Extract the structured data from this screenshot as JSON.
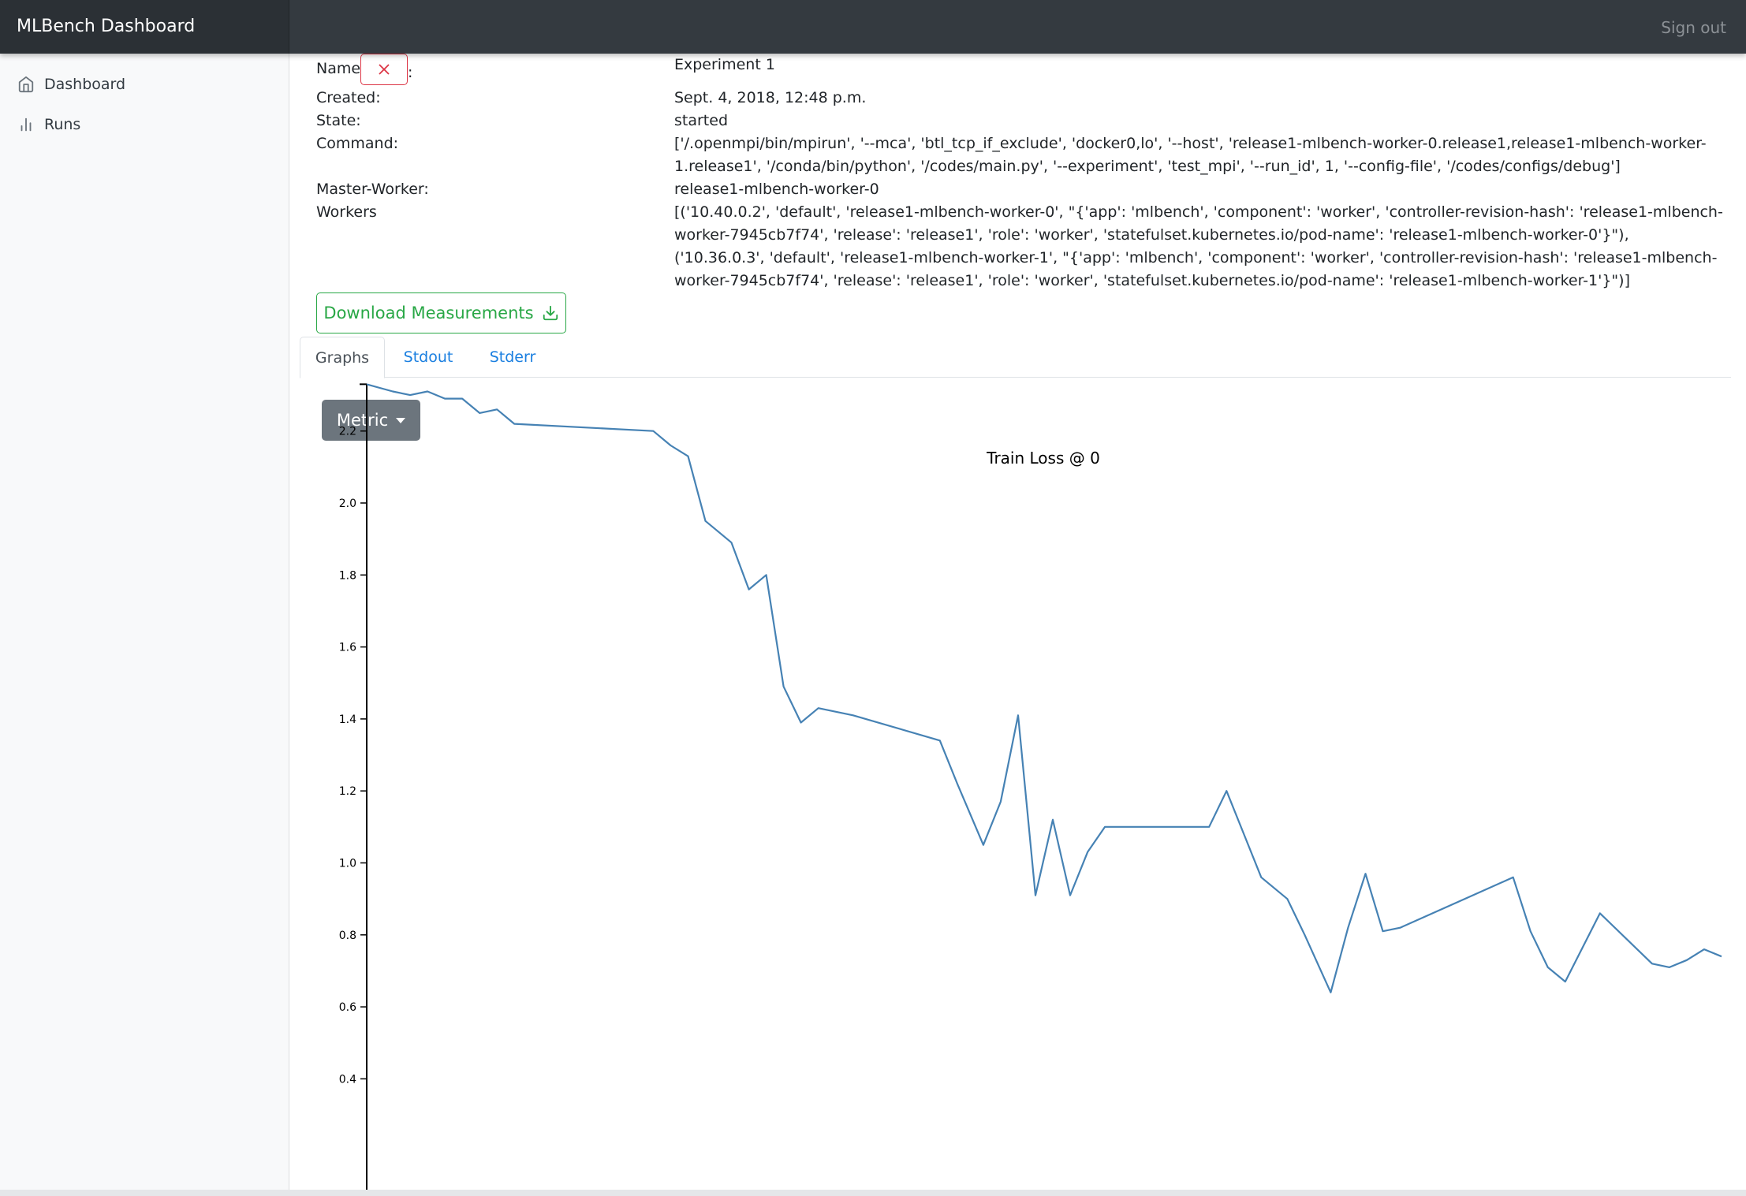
{
  "header": {
    "brand": "MLBench Dashboard",
    "signout_label": "Sign out"
  },
  "sidebar": {
    "items": [
      {
        "label": "Dashboard",
        "icon": "home-icon"
      },
      {
        "label": "Runs",
        "icon": "bar-chart-icon"
      }
    ]
  },
  "run": {
    "name_label": "Name",
    "name_value": "Experiment 1",
    "created_label": "Created:",
    "created_value": "Sept. 4, 2018, 12:48 p.m.",
    "state_label": "State:",
    "state_value": "started",
    "command_label": "Command:",
    "command_value": "['/.openmpi/bin/mpirun', '--mca', 'btl_tcp_if_exclude', 'docker0,lo', '--host', 'release1-mlbench-worker-0.release1,release1-mlbench-worker-1.release1', '/conda/bin/python', '/codes/main.py', '--experiment', 'test_mpi', '--run_id', 1, '--config-file', '/codes/configs/debug']",
    "master_label": "Master-Worker:",
    "master_value": "release1-mlbench-worker-0",
    "workers_label": "Workers",
    "workers_value": "[('10.40.0.2', 'default', 'release1-mlbench-worker-0', \"{'app': 'mlbench', 'component': 'worker', 'controller-revision-hash': 'release1-mlbench-worker-7945cb7f74', 'release': 'release1', 'role': 'worker', 'statefulset.kubernetes.io/pod-name': 'release1-mlbench-worker-0'}\"), ('10.36.0.3', 'default', 'release1-mlbench-worker-1', \"{'app': 'mlbench', 'component': 'worker', 'controller-revision-hash': 'release1-mlbench-worker-7945cb7f74', 'release': 'release1', 'role': 'worker', 'statefulset.kubernetes.io/pod-name': 'release1-mlbench-worker-1'}\")]"
  },
  "actions": {
    "download_label": "Download Measurements"
  },
  "tabs": [
    {
      "label": "Graphs",
      "active": true
    },
    {
      "label": "Stdout",
      "active": false
    },
    {
      "label": "Stderr",
      "active": false
    }
  ],
  "metric_button_label": "Metric",
  "colors": {
    "line": "#4682b4",
    "success": "#28a745",
    "danger": "#dc3545",
    "link": "#1a7fe0"
  },
  "chart_data": {
    "type": "line",
    "title": "Train Loss @ 0",
    "xlabel": "",
    "ylabel": "",
    "ylim": [
      0.3,
      2.33
    ],
    "yticks": [
      0.4,
      0.6,
      0.8,
      1.0,
      1.2,
      1.4,
      1.6,
      1.8,
      2.0,
      2.2
    ],
    "ytick_labels": [
      "0.4",
      "0.6",
      "0.8",
      "1.0",
      "1.2",
      "1.4",
      "1.6",
      "1.8",
      "2.0",
      "2.2"
    ],
    "grid": false,
    "legend": "none",
    "x": [
      0,
      3,
      5,
      7,
      9,
      11,
      13,
      15,
      17,
      33,
      35,
      37,
      39,
      42,
      44,
      46,
      48,
      50,
      52,
      56,
      66,
      68,
      71,
      73,
      75,
      77,
      79,
      81,
      83,
      85,
      89,
      97,
      99,
      101,
      103,
      106,
      108,
      111,
      113,
      115,
      117,
      119,
      132,
      134,
      136,
      138,
      142,
      148,
      150,
      152,
      154,
      156
    ],
    "y": [
      2.33,
      2.31,
      2.3,
      2.31,
      2.29,
      2.29,
      2.25,
      2.26,
      2.22,
      2.2,
      2.16,
      2.13,
      1.95,
      1.89,
      1.76,
      1.8,
      1.49,
      1.39,
      1.43,
      1.41,
      1.34,
      1.22,
      1.05,
      1.17,
      1.41,
      0.91,
      1.12,
      0.91,
      1.03,
      1.1,
      1.1,
      1.1,
      1.2,
      1.08,
      0.96,
      0.9,
      0.8,
      0.64,
      0.82,
      0.97,
      0.81,
      0.82,
      0.96,
      0.81,
      0.71,
      0.67,
      0.86,
      0.72,
      0.71,
      0.73,
      0.76,
      0.74
    ]
  }
}
